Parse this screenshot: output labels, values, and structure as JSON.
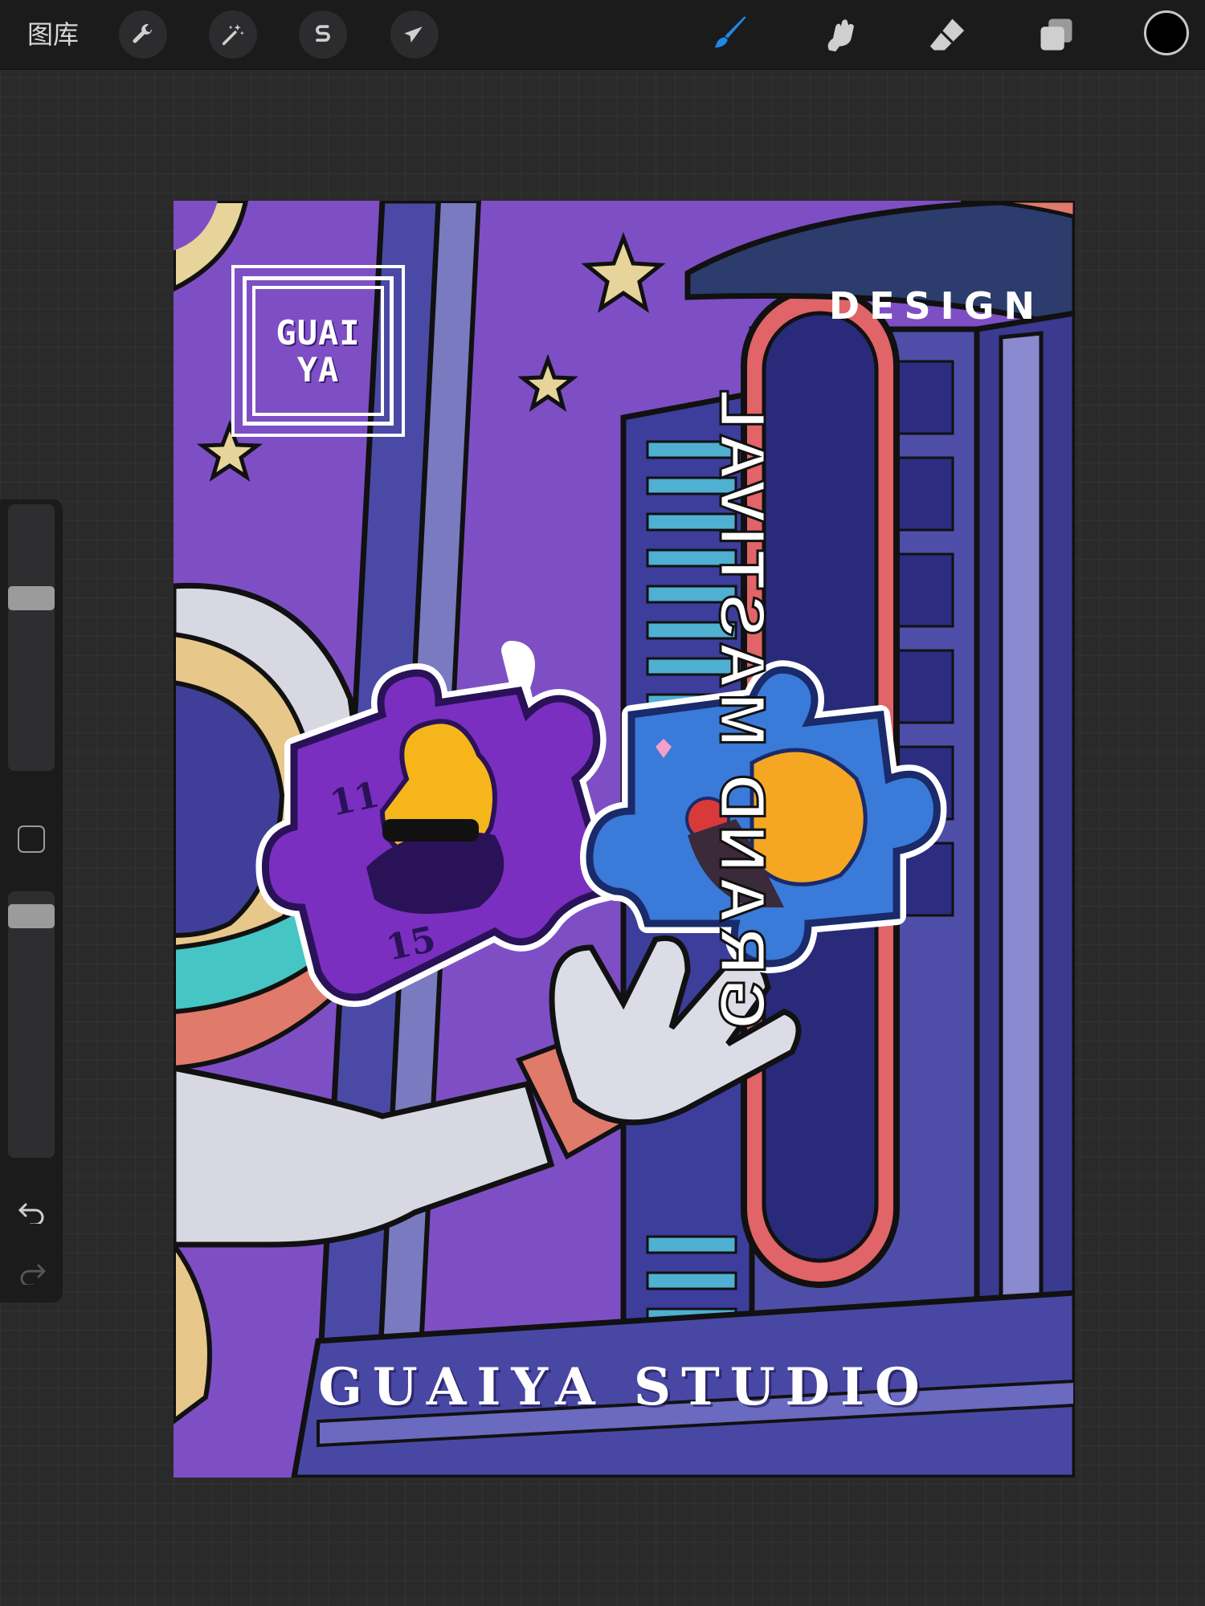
{
  "toolbar": {
    "gallery_label": "图库",
    "left_tools": [
      {
        "name": "actions-wrench-icon"
      },
      {
        "name": "adjustments-magic-wand-icon"
      },
      {
        "name": "selection-s-icon"
      },
      {
        "name": "transform-arrow-icon"
      }
    ],
    "right_tools": [
      {
        "name": "brush-icon",
        "active": true
      },
      {
        "name": "smudge-icon",
        "active": false
      },
      {
        "name": "eraser-icon",
        "active": false
      },
      {
        "name": "layers-icon",
        "active": false
      }
    ],
    "active_color": "#000000",
    "accent_color": "#1e88e5"
  },
  "sidebar": {
    "brush_size_level": 0.32,
    "opacity_level": 0.05
  },
  "artwork": {
    "logo_line1": "GUAI",
    "logo_line2": "YA",
    "corner_text": "DESIGN",
    "sign_text": "GRAND MASTIVAL",
    "footer_text": "GUAIYA STUDIO",
    "puzzle_num_1": "11",
    "puzzle_num_2": "15",
    "background_color": "#7e4fc4"
  }
}
